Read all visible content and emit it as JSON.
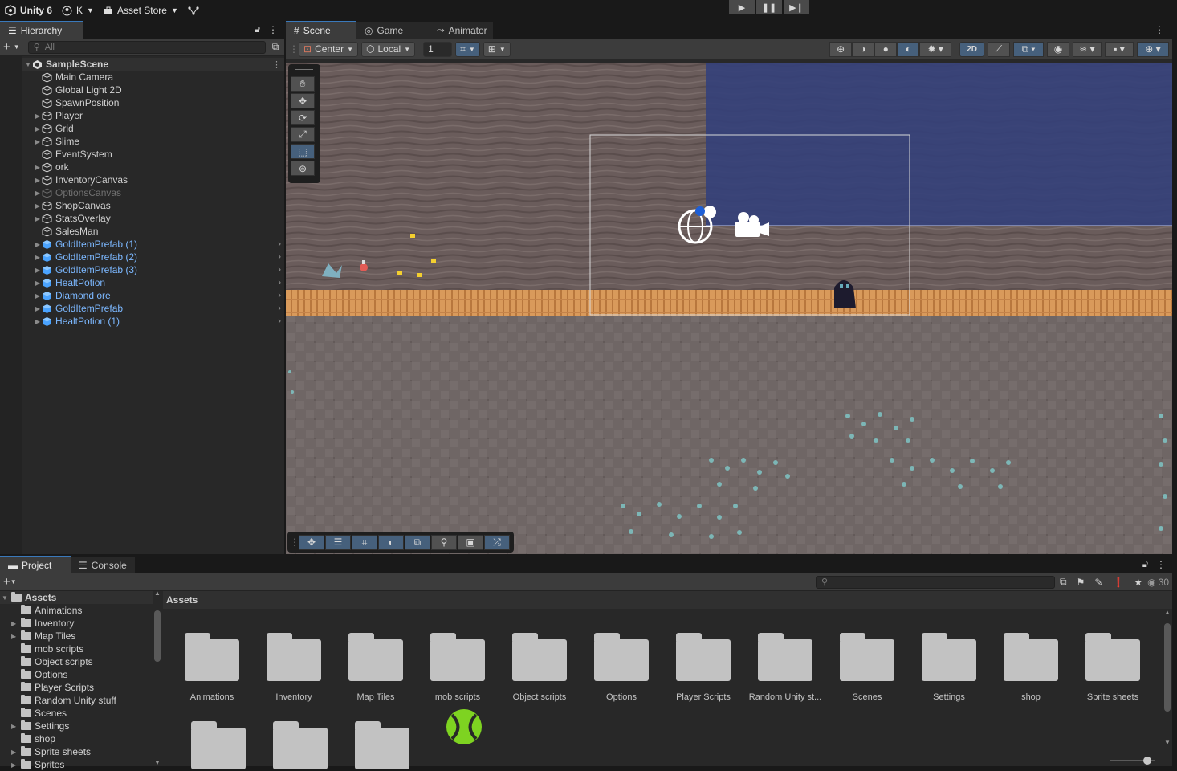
{
  "topbar": {
    "app_label": "Unity 6",
    "account_label": "K",
    "asset_store_label": "Asset Store"
  },
  "hierarchy": {
    "tab_label": "Hierarchy",
    "search_placeholder": "All",
    "scene_name": "SampleScene",
    "items": [
      {
        "label": "Main Camera",
        "type": "object",
        "expandable": false
      },
      {
        "label": "Global Light 2D",
        "type": "object",
        "expandable": false
      },
      {
        "label": "SpawnPosition",
        "type": "object",
        "expandable": false
      },
      {
        "label": "Player",
        "type": "object",
        "expandable": true
      },
      {
        "label": "Grid",
        "type": "object",
        "expandable": true
      },
      {
        "label": "Slime",
        "type": "object",
        "expandable": true
      },
      {
        "label": "EventSystem",
        "type": "object",
        "expandable": false
      },
      {
        "label": "ork",
        "type": "object",
        "expandable": true
      },
      {
        "label": "InventoryCanvas",
        "type": "object",
        "expandable": true
      },
      {
        "label": "OptionsCanvas",
        "type": "inactive",
        "expandable": true
      },
      {
        "label": "ShopCanvas",
        "type": "object",
        "expandable": true
      },
      {
        "label": "StatsOverlay",
        "type": "object",
        "expandable": true
      },
      {
        "label": "SalesMan",
        "type": "object",
        "expandable": false
      },
      {
        "label": "GoldItemPrefab (1)",
        "type": "prefab",
        "expandable": true
      },
      {
        "label": "GoldItemPrefab (2)",
        "type": "prefab",
        "expandable": true
      },
      {
        "label": "GoldItemPrefab (3)",
        "type": "prefab",
        "expandable": true
      },
      {
        "label": "HealtPotion",
        "type": "prefab",
        "expandable": true
      },
      {
        "label": "Diamond ore",
        "type": "prefab",
        "expandable": true
      },
      {
        "label": "GoldItemPrefab",
        "type": "prefab",
        "expandable": true
      },
      {
        "label": "HealtPotion (1)",
        "type": "prefab",
        "expandable": true
      }
    ]
  },
  "scene": {
    "tabs": [
      {
        "label": "Scene",
        "icon": "hash-icon"
      },
      {
        "label": "Game",
        "icon": "gamepad-icon"
      },
      {
        "label": "Animator",
        "icon": "animator-icon"
      }
    ],
    "pivot_label": "Center",
    "space_label": "Local",
    "grid_value": "1",
    "mode_2d_label": "2D"
  },
  "project": {
    "tabs": [
      {
        "label": "Project",
        "icon": "folder-icon"
      },
      {
        "label": "Console",
        "icon": "console-icon"
      }
    ],
    "hidden_count": "30",
    "breadcrumb": "Assets",
    "tree": [
      {
        "label": "Assets",
        "root": true,
        "expandable": true
      },
      {
        "label": "Animations",
        "expandable": false
      },
      {
        "label": "Inventory",
        "expandable": true
      },
      {
        "label": "Map Tiles",
        "expandable": true
      },
      {
        "label": "mob scripts",
        "expandable": false
      },
      {
        "label": "Object scripts",
        "expandable": false
      },
      {
        "label": "Options",
        "expandable": false
      },
      {
        "label": "Player Scripts",
        "expandable": false
      },
      {
        "label": "Random Unity stuff",
        "expandable": false
      },
      {
        "label": "Scenes",
        "expandable": false
      },
      {
        "label": "Settings",
        "expandable": true
      },
      {
        "label": "shop",
        "expandable": false
      },
      {
        "label": "Sprite sheets",
        "expandable": true
      },
      {
        "label": "Sprites",
        "expandable": true
      }
    ],
    "grid_items": [
      {
        "label": "Animations"
      },
      {
        "label": "Inventory"
      },
      {
        "label": "Map Tiles"
      },
      {
        "label": "mob scripts"
      },
      {
        "label": "Object scripts"
      },
      {
        "label": "Options"
      },
      {
        "label": "Player Scripts"
      },
      {
        "label": "Random Unity st..."
      },
      {
        "label": "Scenes"
      },
      {
        "label": "Settings"
      },
      {
        "label": "shop"
      },
      {
        "label": "Sprite sheets"
      }
    ]
  }
}
